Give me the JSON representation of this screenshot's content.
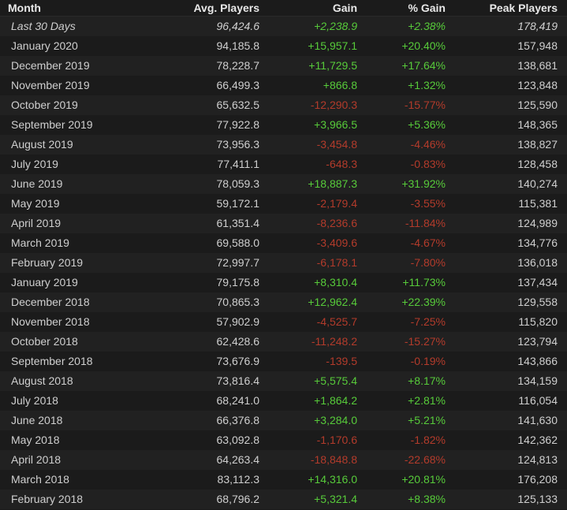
{
  "table": {
    "headers": {
      "month": "Month",
      "avg_players": "Avg. Players",
      "gain": "Gain",
      "pct_gain": "% Gain",
      "peak_players": "Peak Players"
    },
    "rows": [
      {
        "month": "Last 30 Days",
        "avg": "96,424.6",
        "gain": "+2,238.9",
        "pct": "+2.38%",
        "peak": "178,419",
        "trend": "pos",
        "italic": true
      },
      {
        "month": "January 2020",
        "avg": "94,185.8",
        "gain": "+15,957.1",
        "pct": "+20.40%",
        "peak": "157,948",
        "trend": "pos"
      },
      {
        "month": "December 2019",
        "avg": "78,228.7",
        "gain": "+11,729.5",
        "pct": "+17.64%",
        "peak": "138,681",
        "trend": "pos"
      },
      {
        "month": "November 2019",
        "avg": "66,499.3",
        "gain": "+866.8",
        "pct": "+1.32%",
        "peak": "123,848",
        "trend": "pos"
      },
      {
        "month": "October 2019",
        "avg": "65,632.5",
        "gain": "-12,290.3",
        "pct": "-15.77%",
        "peak": "125,590",
        "trend": "neg"
      },
      {
        "month": "September 2019",
        "avg": "77,922.8",
        "gain": "+3,966.5",
        "pct": "+5.36%",
        "peak": "148,365",
        "trend": "pos"
      },
      {
        "month": "August 2019",
        "avg": "73,956.3",
        "gain": "-3,454.8",
        "pct": "-4.46%",
        "peak": "138,827",
        "trend": "neg"
      },
      {
        "month": "July 2019",
        "avg": "77,411.1",
        "gain": "-648.3",
        "pct": "-0.83%",
        "peak": "128,458",
        "trend": "neg"
      },
      {
        "month": "June 2019",
        "avg": "78,059.3",
        "gain": "+18,887.3",
        "pct": "+31.92%",
        "peak": "140,274",
        "trend": "pos"
      },
      {
        "month": "May 2019",
        "avg": "59,172.1",
        "gain": "-2,179.4",
        "pct": "-3.55%",
        "peak": "115,381",
        "trend": "neg"
      },
      {
        "month": "April 2019",
        "avg": "61,351.4",
        "gain": "-8,236.6",
        "pct": "-11.84%",
        "peak": "124,989",
        "trend": "neg"
      },
      {
        "month": "March 2019",
        "avg": "69,588.0",
        "gain": "-3,409.6",
        "pct": "-4.67%",
        "peak": "134,776",
        "trend": "neg"
      },
      {
        "month": "February 2019",
        "avg": "72,997.7",
        "gain": "-6,178.1",
        "pct": "-7.80%",
        "peak": "136,018",
        "trend": "neg"
      },
      {
        "month": "January 2019",
        "avg": "79,175.8",
        "gain": "+8,310.4",
        "pct": "+11.73%",
        "peak": "137,434",
        "trend": "pos"
      },
      {
        "month": "December 2018",
        "avg": "70,865.3",
        "gain": "+12,962.4",
        "pct": "+22.39%",
        "peak": "129,558",
        "trend": "pos"
      },
      {
        "month": "November 2018",
        "avg": "57,902.9",
        "gain": "-4,525.7",
        "pct": "-7.25%",
        "peak": "115,820",
        "trend": "neg"
      },
      {
        "month": "October 2018",
        "avg": "62,428.6",
        "gain": "-11,248.2",
        "pct": "-15.27%",
        "peak": "123,794",
        "trend": "neg"
      },
      {
        "month": "September 2018",
        "avg": "73,676.9",
        "gain": "-139.5",
        "pct": "-0.19%",
        "peak": "143,866",
        "trend": "neg"
      },
      {
        "month": "August 2018",
        "avg": "73,816.4",
        "gain": "+5,575.4",
        "pct": "+8.17%",
        "peak": "134,159",
        "trend": "pos"
      },
      {
        "month": "July 2018",
        "avg": "68,241.0",
        "gain": "+1,864.2",
        "pct": "+2.81%",
        "peak": "116,054",
        "trend": "pos"
      },
      {
        "month": "June 2018",
        "avg": "66,376.8",
        "gain": "+3,284.0",
        "pct": "+5.21%",
        "peak": "141,630",
        "trend": "pos"
      },
      {
        "month": "May 2018",
        "avg": "63,092.8",
        "gain": "-1,170.6",
        "pct": "-1.82%",
        "peak": "142,362",
        "trend": "neg"
      },
      {
        "month": "April 2018",
        "avg": "64,263.4",
        "gain": "-18,848.8",
        "pct": "-22.68%",
        "peak": "124,813",
        "trend": "neg"
      },
      {
        "month": "March 2018",
        "avg": "83,112.3",
        "gain": "+14,316.0",
        "pct": "+20.81%",
        "peak": "176,208",
        "trend": "pos"
      },
      {
        "month": "February 2018",
        "avg": "68,796.2",
        "gain": "+5,321.4",
        "pct": "+8.38%",
        "peak": "125,133",
        "trend": "pos"
      }
    ]
  },
  "colors": {
    "background": "#1b1b1b",
    "row_alt": "#212121",
    "text": "#cfcfcf",
    "positive": "#57cb3a",
    "negative": "#b33b2b"
  }
}
